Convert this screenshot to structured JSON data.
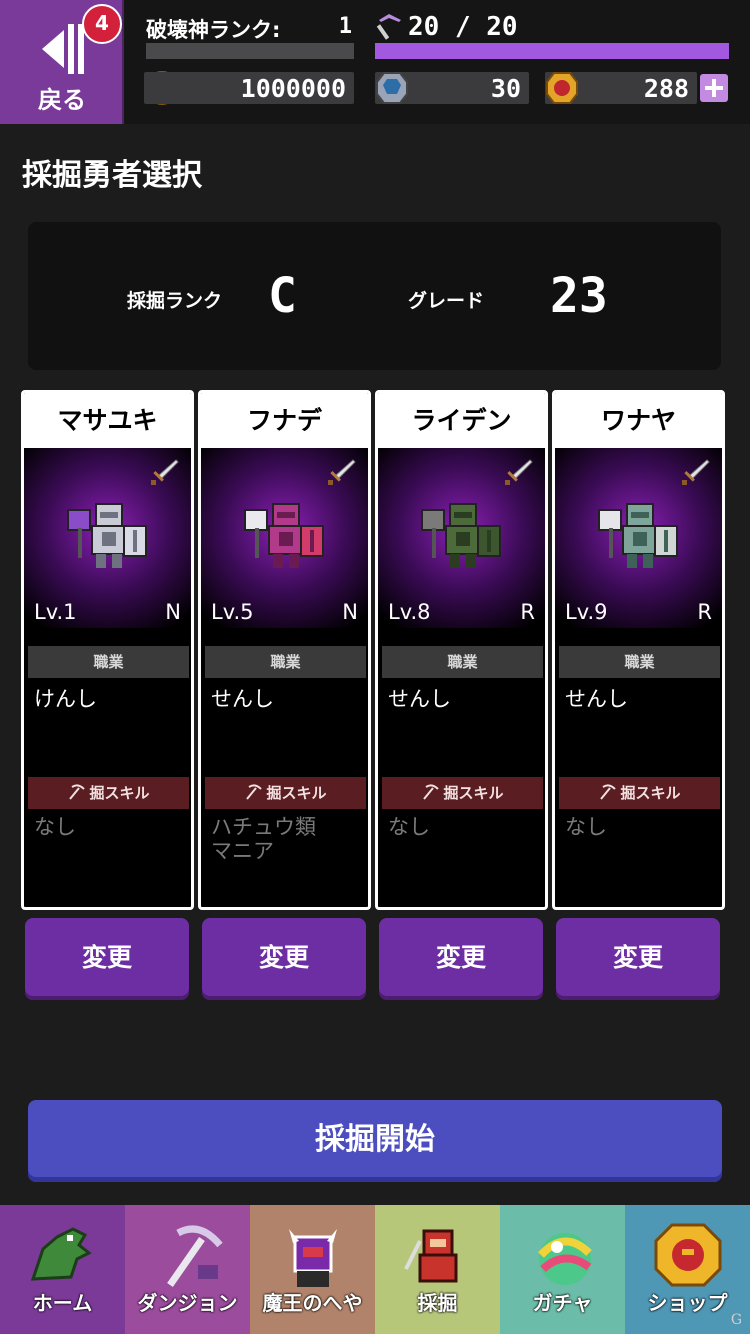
{
  "topbar": {
    "back_label": "戻る",
    "rank_label": "破壊神ランク:",
    "rank_value": "1",
    "stamina": "20 / 20",
    "stamina_fill": 1.0,
    "points": "1000000",
    "crystals": "30",
    "gems": "288",
    "icons": [
      "back-icon",
      "pickaxe-icon",
      "p-coin-icon",
      "crystal-icon",
      "gem-icon",
      "plus-icon"
    ]
  },
  "page": {
    "title": "採掘勇者選択",
    "dig_rank_label": "採掘ランク",
    "dig_rank_value": "C",
    "grade_label": "グレード",
    "grade_value": "23"
  },
  "heroes": [
    {
      "name": "マサユキ",
      "level": "Lv.1",
      "rarity": "N",
      "job_header": "職業",
      "job": "けんし",
      "skill_header": "掘スキル",
      "skill": "なし",
      "change": "変更",
      "palette": "silver"
    },
    {
      "name": "フナデ",
      "level": "Lv.5",
      "rarity": "N",
      "job_header": "職業",
      "job": "せんし",
      "skill_header": "掘スキル",
      "skill": "ハチュウ類\nマニア",
      "change": "変更",
      "palette": "magenta"
    },
    {
      "name": "ライデン",
      "level": "Lv.8",
      "rarity": "R",
      "job_header": "職業",
      "job": "せんし",
      "skill_header": "掘スキル",
      "skill": "なし",
      "change": "変更",
      "palette": "olive"
    },
    {
      "name": "ワナヤ",
      "level": "Lv.9",
      "rarity": "R",
      "job_header": "職業",
      "job": "せんし",
      "skill_header": "掘スキル",
      "skill": "なし",
      "change": "変更",
      "palette": "teal"
    }
  ],
  "start_label": "採掘開始",
  "nav": [
    {
      "label": "ホーム",
      "icon": "dragon-icon",
      "bg": "#7b3a97"
    },
    {
      "label": "ダンジョン",
      "icon": "dungeon-pickaxe-icon",
      "bg": "#9b4c9d"
    },
    {
      "label": "魔王のへや",
      "icon": "demon-lord-icon",
      "bg": "#b1836a"
    },
    {
      "label": "採掘",
      "icon": "dig-hero-icon",
      "bg": "#b7c77a"
    },
    {
      "label": "ガチャ",
      "icon": "gacha-orb-icon",
      "bg": "#6bbca8"
    },
    {
      "label": "ショップ",
      "icon": "shop-gem-icon",
      "bg": "#4e97b5"
    }
  ],
  "nav_badge": "4",
  "watermark": "G"
}
